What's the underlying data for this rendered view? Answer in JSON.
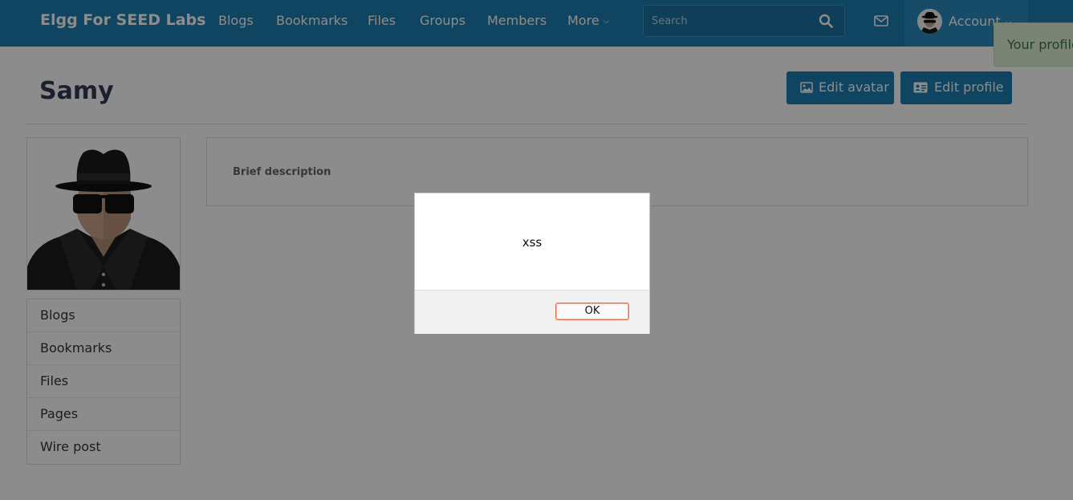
{
  "nav": {
    "brand": "Elgg For SEED Labs",
    "items": [
      "Blogs",
      "Bookmarks",
      "Files",
      "Groups",
      "Members",
      "More"
    ],
    "search_placeholder": "Search",
    "account_label": "Account",
    "accent_color": "#1e7fb2"
  },
  "toast": {
    "text": "Your profile"
  },
  "profile": {
    "name": "Samy",
    "edit_avatar_label": "Edit avatar",
    "edit_profile_label": "Edit profile",
    "brief_description_label": "Brief description"
  },
  "sidebar": {
    "items": [
      {
        "label": "Blogs"
      },
      {
        "label": "Bookmarks"
      },
      {
        "label": "Files"
      },
      {
        "label": "Pages"
      },
      {
        "label": "Wire post"
      }
    ]
  },
  "dialog": {
    "message": "xss",
    "ok_label": "OK"
  }
}
